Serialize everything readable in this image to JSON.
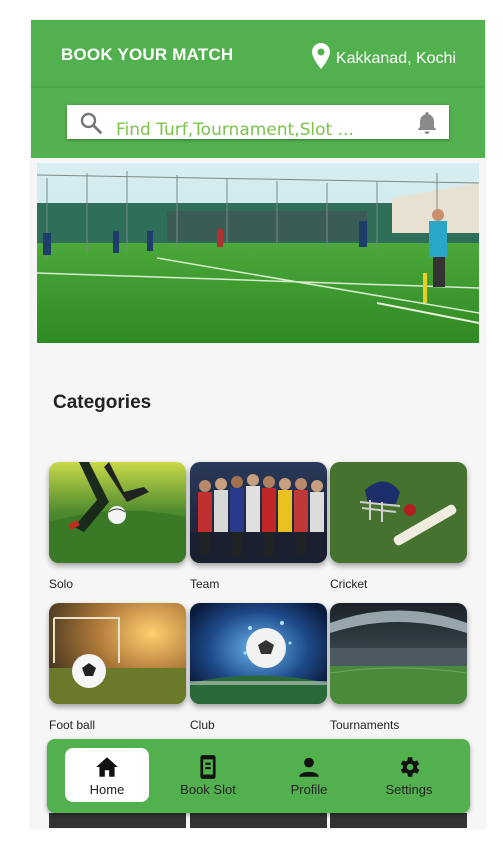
{
  "header": {
    "title": "BOOK YOUR MATCH",
    "location": "Kakkanad, Kochi",
    "location_icon": "location-pin-icon"
  },
  "search": {
    "placeholder": "Find Turf,Tournament,Slot ...",
    "search_icon": "search-icon",
    "notification_icon": "bell-icon"
  },
  "categories": {
    "title": "Categories",
    "items": [
      {
        "label": "Solo"
      },
      {
        "label": "Team"
      },
      {
        "label": "Cricket"
      },
      {
        "label": "Foot ball"
      },
      {
        "label": "Club"
      },
      {
        "label": "Tournaments"
      }
    ]
  },
  "bottom_nav": {
    "items": [
      {
        "label": "Home",
        "icon": "home-icon",
        "active": true
      },
      {
        "label": "Book Slot",
        "icon": "book-slot-icon",
        "active": false
      },
      {
        "label": "Profile",
        "icon": "person-icon",
        "active": false
      },
      {
        "label": "Settings",
        "icon": "gear-icon",
        "active": false
      }
    ]
  },
  "colors": {
    "primary_green": "#52b04f",
    "placeholder_green": "#7cc34a",
    "background": "#f6f6f6"
  }
}
